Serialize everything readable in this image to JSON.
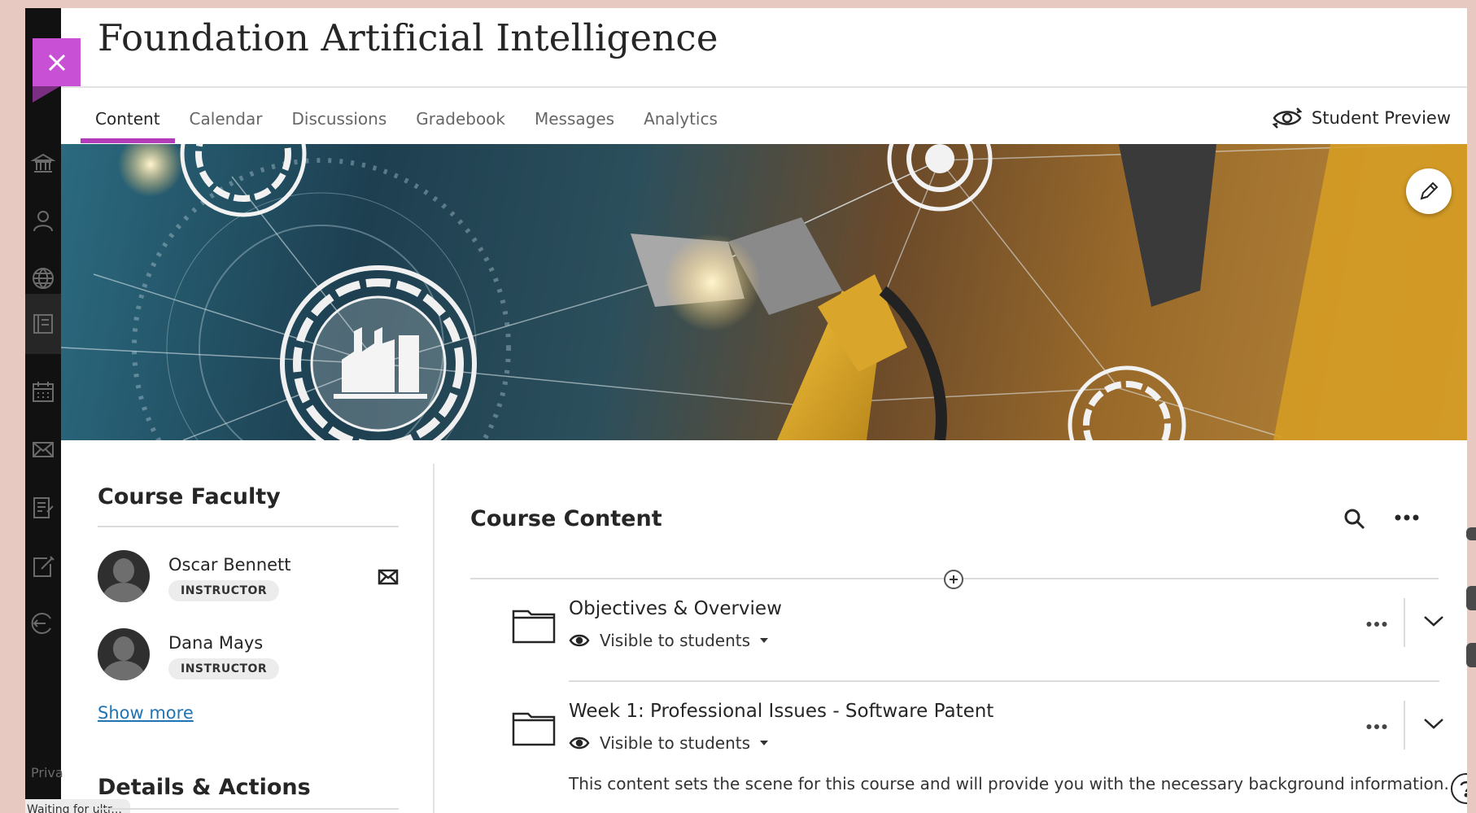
{
  "course": {
    "title": "Foundation Artificial Intelligence"
  },
  "tabs": [
    {
      "label": "Content",
      "active": true
    },
    {
      "label": "Calendar",
      "active": false
    },
    {
      "label": "Discussions",
      "active": false
    },
    {
      "label": "Gradebook",
      "active": false
    },
    {
      "label": "Messages",
      "active": false
    },
    {
      "label": "Analytics",
      "active": false
    }
  ],
  "header": {
    "student_preview_label": "Student Preview"
  },
  "faculty": {
    "heading": "Course Faculty",
    "members": [
      {
        "name": "Oscar Bennett",
        "role": "INSTRUCTOR"
      },
      {
        "name": "Dana Mays",
        "role": "INSTRUCTOR"
      }
    ],
    "show_more_label": "Show more"
  },
  "details": {
    "heading": "Details & Actions"
  },
  "content": {
    "heading": "Course Content",
    "items": [
      {
        "title": "Objectives & Overview",
        "visibility": "Visible to students",
        "description": ""
      },
      {
        "title": "Week 1: Professional Issues - Software Patent",
        "visibility": "Visible to students",
        "description": "This content sets the scene for this course and will provide you with the necessary background information."
      }
    ]
  },
  "footer": {
    "privacy_label": "Priva",
    "status_text": "Waiting for ultr..."
  },
  "colors": {
    "accent": "#b23cb8",
    "close_tab": "#c850d4",
    "link": "#1f74b6",
    "nav_bg": "#111111"
  },
  "icons": [
    "close-icon",
    "institution-icon",
    "profile-icon",
    "globe-icon",
    "courses-icon",
    "calendar-icon",
    "mail-icon",
    "grades-icon",
    "edit-note-icon",
    "sign-out-icon",
    "student-preview-icon",
    "pencil-icon",
    "search-icon",
    "more-icon",
    "add-icon",
    "folder-icon",
    "eye-icon",
    "chevron-down-icon",
    "help-icon"
  ]
}
